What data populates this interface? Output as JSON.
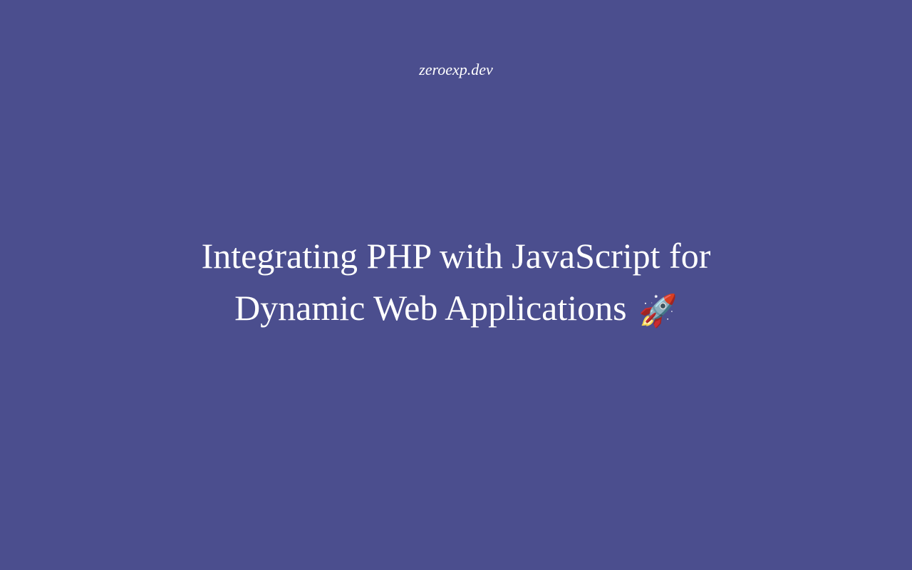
{
  "site": {
    "name": "zeroexp.dev"
  },
  "article": {
    "title_line1": "Integrating PHP with JavaScript for",
    "title_line2": "Dynamic Web Applications",
    "emoji": "🚀"
  }
}
